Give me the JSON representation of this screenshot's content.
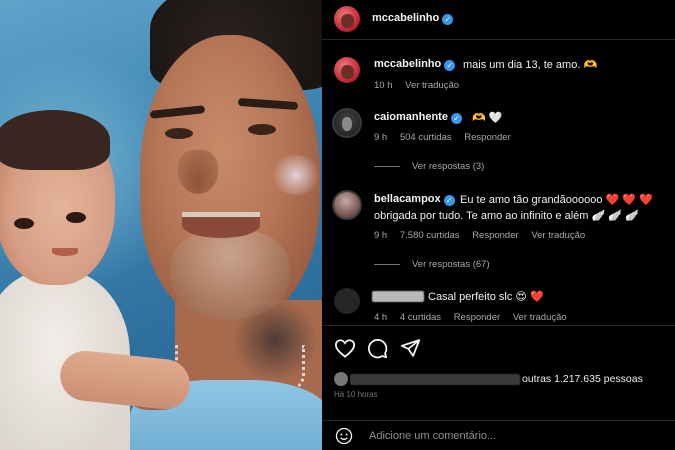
{
  "post": {
    "author": "mccabelinho",
    "verified": true
  },
  "caption": {
    "username": "mccabelinho",
    "text": "mais um dia 13, te amo. 🫶",
    "time": "10 h",
    "translate": "Ver tradução"
  },
  "comments": [
    {
      "username": "caiomanhente",
      "verified": true,
      "text": "🫶 🤍",
      "time": "9 h",
      "likes": "504 curtidas",
      "reply": "Responder",
      "view_replies": "Ver respostas (3)"
    },
    {
      "username": "bellacampox",
      "verified": true,
      "text_line1": "Eu te amo tão grandãoooooo ❤️ ❤️ ❤️",
      "text_line2": "obrigada por tudo. Te amo ao infinito e além 🪽 🪽 🪽",
      "time": "9 h",
      "likes": "7.580 curtidas",
      "reply": "Responder",
      "translate": "Ver tradução",
      "view_replies": "Ver respostas (67)"
    },
    {
      "username": "",
      "text": "Casal perfeito slc 😍 ❤️",
      "time": "4 h",
      "likes": "4 curtidas",
      "reply": "Responder",
      "translate": "Ver tradução"
    }
  ],
  "likes_line": "outras 1.217.635 pessoas",
  "date_line": "Há 10 horas",
  "comment_input": {
    "placeholder": "Adicione um comentário..."
  },
  "icons": [
    "heart-icon",
    "comment-icon",
    "share-icon",
    "emoji-icon"
  ],
  "colors": {
    "background": "#000000",
    "verified": "#3797f0",
    "secondary_text": "#a8a8a8"
  }
}
